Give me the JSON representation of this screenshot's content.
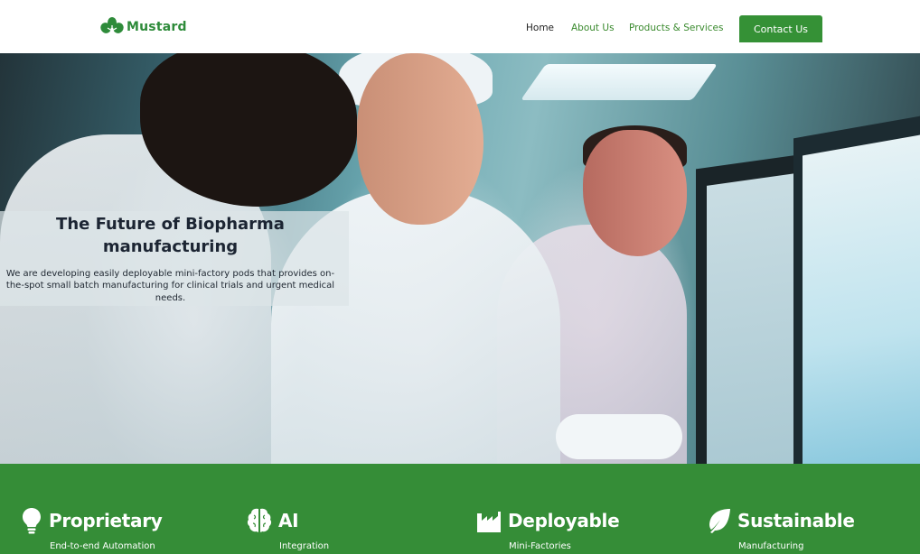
{
  "header": {
    "logo_text": "Mustard",
    "nav": {
      "home": "Home",
      "about": "About Us",
      "products": "Products & Services"
    },
    "contact_button": "Contact Us"
  },
  "hero": {
    "title_line1": "The Future of Biopharma",
    "title_line2": "manufacturing",
    "description": "We are developing easily deployable mini-factory pods that provides on-the-spot small batch manufacturing for clinical trials and urgent medical needs."
  },
  "features": [
    {
      "icon": "lightbulb-icon",
      "title": "Proprietary",
      "subtitle": "End-to-end Automation"
    },
    {
      "icon": "brain-icon",
      "title": "AI",
      "subtitle": "Integration"
    },
    {
      "icon": "factory-icon",
      "title": "Deployable",
      "subtitle": "Mini-Factories"
    },
    {
      "icon": "leaf-icon",
      "title": "Sustainable",
      "subtitle": "Manufacturing"
    }
  ],
  "colors": {
    "brand_green": "#358d37",
    "nav_green": "#3a8a2e",
    "white": "#ffffff"
  }
}
